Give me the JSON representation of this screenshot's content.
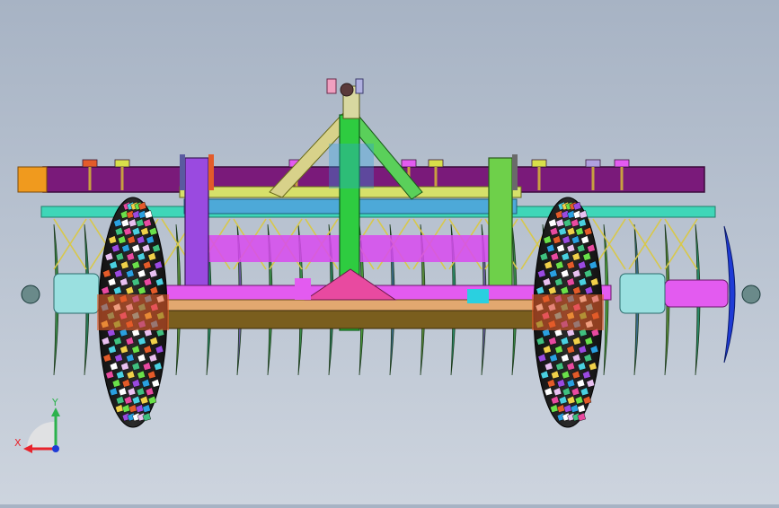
{
  "viewport": {
    "background_top": "#a7b3c4",
    "background_bottom": "#cdd4de"
  },
  "triad": {
    "x_label": "X",
    "y_label": "Y",
    "x_color": "#e8232b",
    "y_color": "#2bb24c",
    "z_color": "#1f3bd6"
  },
  "model": {
    "frame_color": "#7a1a7a",
    "beam_color": "#4da9d8",
    "subframe_color": "#3fd6b8",
    "mast_color": "#2ecc40",
    "brace_color": "#d8d28a",
    "deck_color": "#e2a870",
    "deck_edge_color": "#7a5e1e",
    "axle_color": "#e35bf0",
    "disc_color": "#3a8a4a",
    "tire_color": "#1f1f1f",
    "end_cap_color": "#f09a1e"
  }
}
